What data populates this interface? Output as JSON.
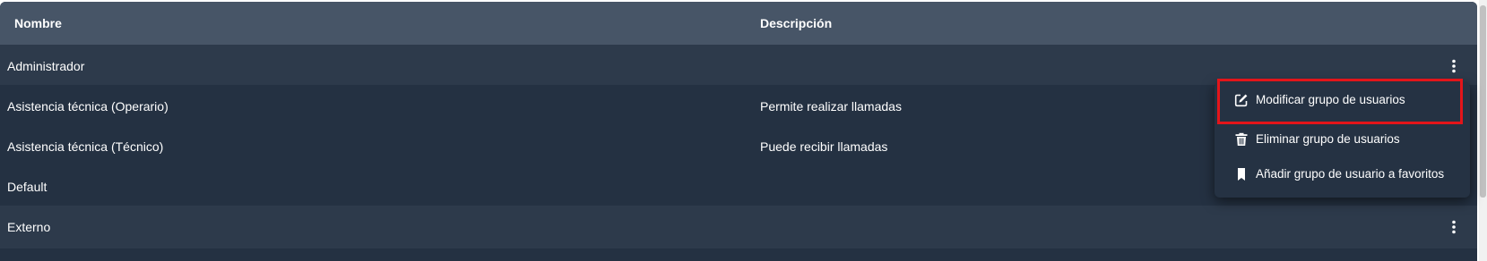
{
  "table": {
    "columns": {
      "name": "Nombre",
      "description": "Descripción"
    },
    "rows": [
      {
        "name": "Administrador",
        "description": "",
        "has_menu": true
      },
      {
        "name": "Asistencia técnica (Operario)",
        "description": "Permite realizar llamadas",
        "has_menu": false
      },
      {
        "name": "Asistencia técnica (Técnico)",
        "description": "Puede recibir llamadas",
        "has_menu": false
      },
      {
        "name": "Default",
        "description": "",
        "has_menu": false
      },
      {
        "name": "Externo",
        "description": "",
        "has_menu": true
      }
    ]
  },
  "context_menu": {
    "items": [
      {
        "label": "Modificar grupo de usuarios",
        "icon": "edit-icon",
        "highlighted": true
      },
      {
        "label": "Eliminar grupo de usuarios",
        "icon": "trash-icon"
      },
      {
        "label": "Añadir grupo de usuario a favoritos",
        "icon": "bookmark-icon"
      }
    ]
  },
  "colors": {
    "header_bg": "#475567",
    "row_odd": "#2d3a4b",
    "row_even": "#243142",
    "menu_bg": "#253243",
    "highlight": "#e3151a",
    "text": "#ffffff"
  }
}
